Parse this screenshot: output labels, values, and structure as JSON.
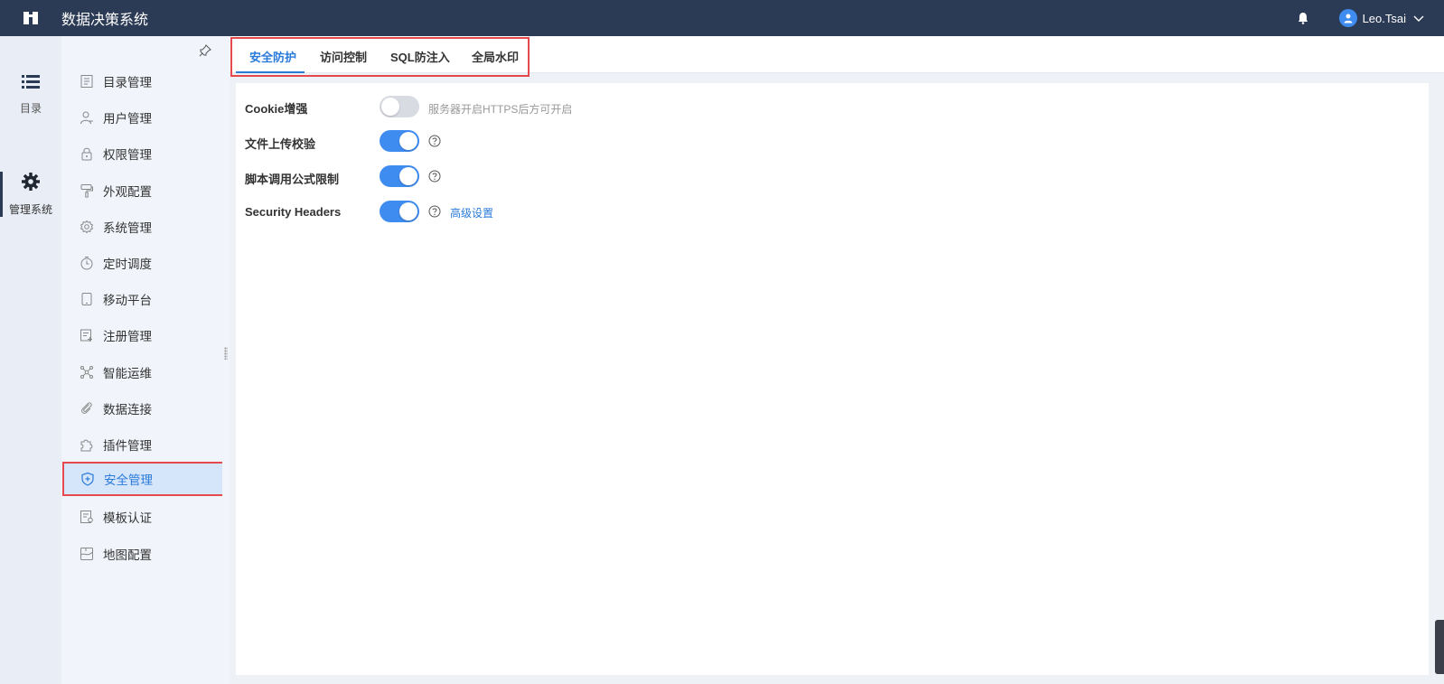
{
  "header": {
    "app_title": "数据决策系统",
    "user_name": "Leo.Tsai"
  },
  "rail": {
    "catalog_label": "目录",
    "manage_label": "管理系统"
  },
  "sidebar": {
    "items": [
      {
        "label": "目录管理",
        "icon": "catalog-icon"
      },
      {
        "label": "用户管理",
        "icon": "user-icon"
      },
      {
        "label": "权限管理",
        "icon": "lock-icon"
      },
      {
        "label": "外观配置",
        "icon": "brush-icon"
      },
      {
        "label": "系统管理",
        "icon": "gear-icon"
      },
      {
        "label": "定时调度",
        "icon": "timer-icon"
      },
      {
        "label": "移动平台",
        "icon": "tablet-icon"
      },
      {
        "label": "注册管理",
        "icon": "register-icon"
      },
      {
        "label": "智能运维",
        "icon": "network-icon"
      },
      {
        "label": "数据连接",
        "icon": "link-icon"
      },
      {
        "label": "插件管理",
        "icon": "puzzle-icon"
      },
      {
        "label": "安全管理",
        "icon": "shield-icon",
        "active": true
      },
      {
        "label": "模板认证",
        "icon": "template-icon"
      },
      {
        "label": "地图配置",
        "icon": "map-icon"
      }
    ]
  },
  "tabs": [
    {
      "label": "安全防护",
      "active": true
    },
    {
      "label": "访问控制"
    },
    {
      "label": "SQL防注入"
    },
    {
      "label": "全局水印"
    }
  ],
  "settings": [
    {
      "label": "Cookie增强",
      "enabled": false,
      "hint": "服务器开启HTTPS后方可开启"
    },
    {
      "label": "文件上传校验",
      "enabled": true
    },
    {
      "label": "脚本调用公式限制",
      "enabled": true
    },
    {
      "label": "Security Headers",
      "enabled": true,
      "link": "高级设置"
    }
  ],
  "colors": {
    "topbar": "#2b3a55",
    "accent": "#2a7ad9",
    "toggle_on": "#3f8cf0",
    "highlight_box": "#e5484d"
  }
}
